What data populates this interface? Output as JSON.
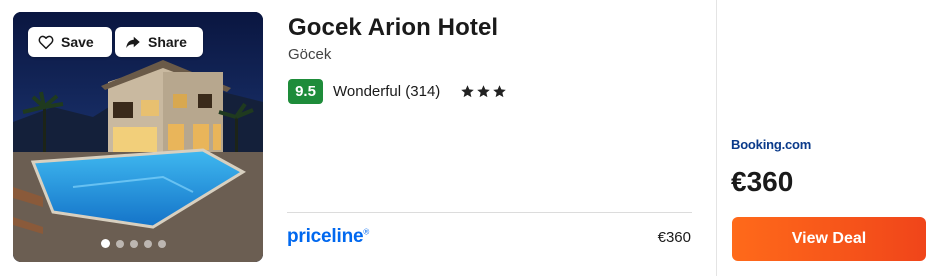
{
  "photo": {
    "save_label": "Save",
    "share_label": "Share",
    "carousel_total": 5,
    "carousel_active": 1
  },
  "hotel": {
    "name": "Gocek Arion Hotel",
    "location": "Göcek",
    "score": "9.5",
    "review_label": "Wonderful (314)",
    "star_count": 3
  },
  "partner_offer": {
    "provider": "priceline",
    "trademark": "®",
    "price": "€360"
  },
  "best_deal": {
    "provider_name": "Booking",
    "provider_suffix": ".com",
    "price": "€360",
    "button_label": "View Deal"
  },
  "colors": {
    "score_bg": "#1e8c3a",
    "priceline_blue": "#0068ef",
    "booking_blue": "#0a3a8a",
    "deal_button": "#f0451a"
  },
  "icons": [
    "heart-outline-icon",
    "share-arrow-icon",
    "star-icon"
  ]
}
